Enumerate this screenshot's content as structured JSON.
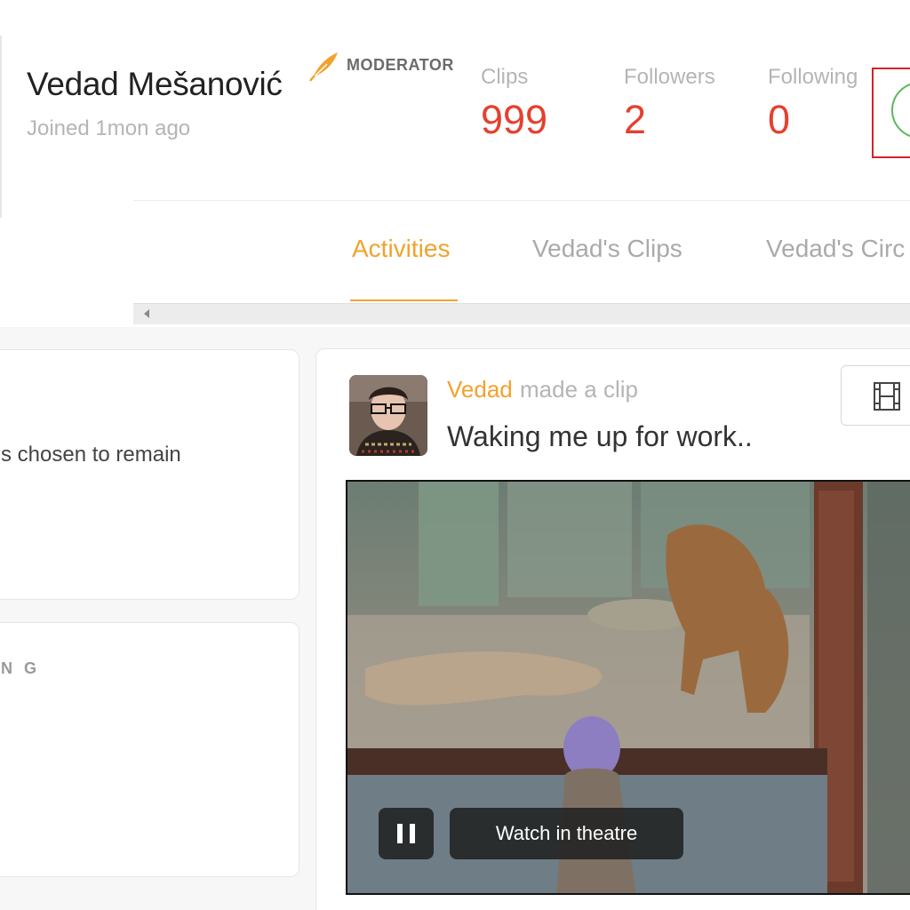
{
  "profile": {
    "name": "Vedad Mešanović",
    "role": "MODERATOR",
    "joined": "Joined 1mon ago"
  },
  "stats": {
    "clips": {
      "label": "Clips",
      "value": "999"
    },
    "followers": {
      "label": "Followers",
      "value": "2"
    },
    "following": {
      "label": "Following",
      "value": "0"
    }
  },
  "tabs": [
    {
      "label": "Activities",
      "active": true
    },
    {
      "label": "Vedad's Clips",
      "active": false
    },
    {
      "label": "Vedad's Circ",
      "active": false
    }
  ],
  "sidebar": {
    "about_text": "s chosen to remain",
    "section_heading": "N G"
  },
  "post": {
    "user": "Vedad",
    "action": "made a clip",
    "title": "Waking me up for work..",
    "watch_label": "Watch in theatre"
  },
  "colors": {
    "accent": "#f2a22d",
    "stat_value": "#e5402f",
    "highlight_box": "#d0242b",
    "follow_circle": "#5cb85c"
  },
  "icons": {
    "badge": "feather-icon",
    "view": "film-strip-icon",
    "pause": "pause-icon",
    "scroll_left": "chevron-left-icon"
  }
}
